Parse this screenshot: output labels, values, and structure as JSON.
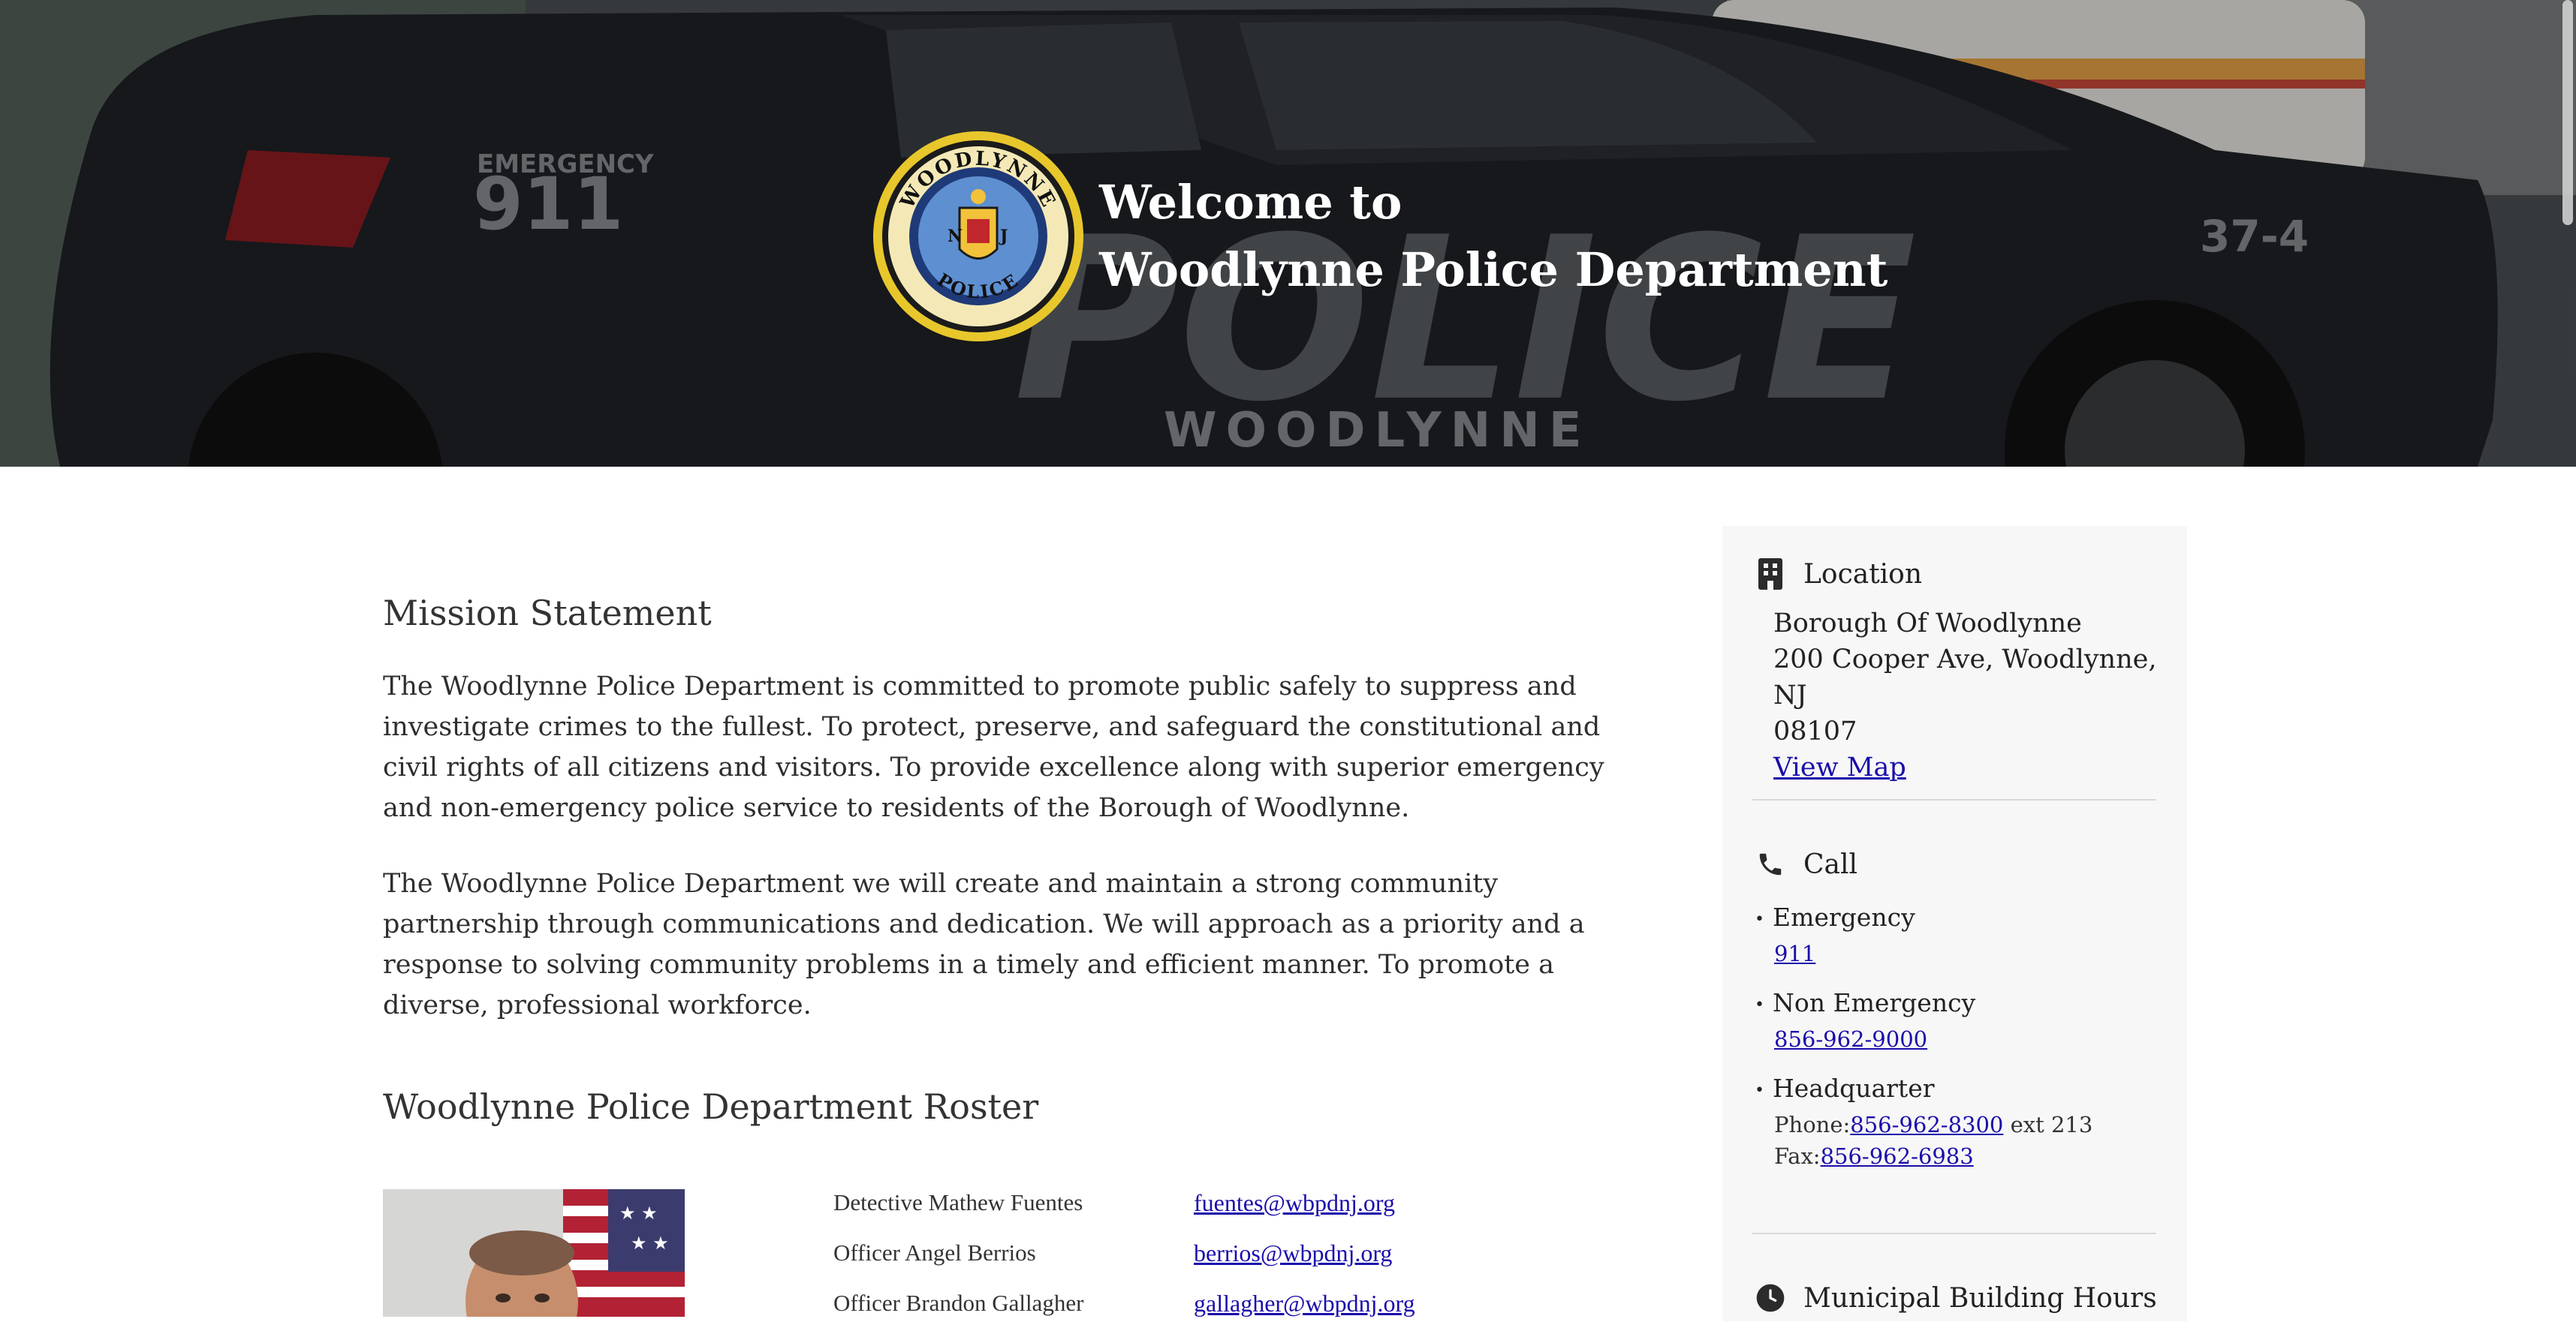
{
  "hero": {
    "welcome": "Welcome to",
    "department": "Woodlynne Police Department",
    "car_text_emergency": "EMERGENCY",
    "car_text_911": "911",
    "car_text_police": "POLICE",
    "car_text_woodlynne": "WOODLYNNE",
    "car_text_unit": "37-4",
    "badge": {
      "top": "WOODLYNNE",
      "bottom": "POLICE",
      "state": "NJ"
    }
  },
  "mission": {
    "heading": "Mission Statement",
    "paragraphs": [
      "The Woodlynne Police Department is committed to promote public safely to suppress and investigate crimes to the fullest. To protect, preserve, and safeguard the constitutional and civil rights of all citizens and visitors. To provide excellence along with superior emergency and non-emergency police service to residents of the Borough of Woodlynne.",
      "The Woodlynne Police Department we will create and maintain a strong community partnership through communications and dedication. We will approach as a priority and a response to solving community problems in a timely and efficient manner. To promote a diverse, professional workforce."
    ]
  },
  "roster": {
    "heading": "Woodlynne Police Department Roster",
    "members": [
      {
        "name": "Detective Mathew Fuentes",
        "email": "fuentes@wbpdnj.org"
      },
      {
        "name": "Officer Angel Berrios",
        "email": "berrios@wbpdnj.org"
      },
      {
        "name": "Officer Brandon Gallagher",
        "email": "gallagher@wbpdnj.org"
      }
    ]
  },
  "sidebar": {
    "location": {
      "title": "Location",
      "icon": "building-icon",
      "line1": "Borough Of Woodlynne",
      "line2": "200 Cooper Ave, Woodlynne, NJ",
      "line3": "08107",
      "map_link": "View Map"
    },
    "call": {
      "title": "Call",
      "icon": "phone-icon",
      "emergency_label": "Emergency",
      "emergency_number": "911",
      "non_emergency_label": "Non Emergency",
      "non_emergency_number": "856-962-9000",
      "hq_label": "Headquarter",
      "hq_phone_prefix": "Phone:",
      "hq_phone": "856-962-8300",
      "hq_ext": "ext 213",
      "hq_fax_prefix": "Fax:",
      "hq_fax": "856-962-6983"
    },
    "hours": {
      "title": "Municipal Building Hours",
      "icon": "clock-icon"
    }
  }
}
